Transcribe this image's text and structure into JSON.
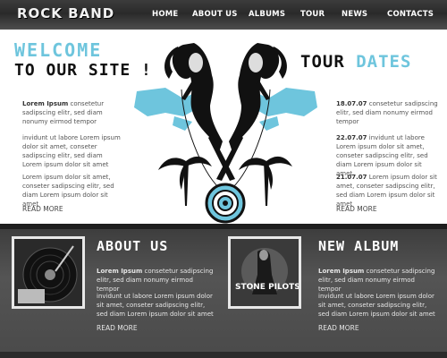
{
  "header": {
    "logo": "ROCK BAND",
    "nav": [
      "HOME",
      "ABOUT US",
      "ALBUMS",
      "TOUR",
      "NEWS",
      "CONTACTS"
    ]
  },
  "welcome": {
    "line1": "WELCOME",
    "line2": "TO OUR SITE !"
  },
  "intro": {
    "p1_bold": "Lorem Ipsum",
    "p1": " consetetur sadipscing elitr, sed diam nonumy eirmod tempor",
    "p2": "invidunt ut labore Lorem ipsum dolor sit amet, conseter sadipscing elitr, sed diam Lorem ipsum dolor sit amet",
    "p3": "Lorem ipsum dolor sit amet, conseter sadipscing elitr, sed diam Lorem ipsum dolor sit amet",
    "more": "READ MORE"
  },
  "tour": {
    "title_a": "TOUR",
    "title_b": "DATES",
    "items": [
      {
        "date": "18.07.07",
        "text": " consetetur sadipscing elitr, sed diam nonumy eirmod tempor"
      },
      {
        "date": "22.07.07",
        "text": " invidunt ut labore Lorem ipsum dolor sit amet, conseter sadipscing elitr, sed diam Lorem ipsum dolor sit amet"
      },
      {
        "date": "21.07.07",
        "text": " Lorem ipsum dolor sit amet, conseter sadipscing elitr, sed diam Lorem ipsum dolor sit amet"
      }
    ],
    "more": "READ MORE"
  },
  "about": {
    "title": "ABOUT US",
    "p1_bold": "Lorem Ipsum",
    "p1": " consetetur sadipscing elitr, sed diam nonumy eirmod tempor",
    "p2": "invidunt ut labore Lorem ipsum dolor sit amet, conseter sadipscing elitr, sed diam Lorem ipsum dolor sit amet",
    "more": "READ MORE"
  },
  "album": {
    "title": "NEW ALBUM",
    "cover_text": "STONE  PILOTS",
    "p1_bold": "Lorem Ipsum",
    "p1": " consetetur sadipscing elitr, sed diam nonumy eirmod tempor",
    "p2": "invidunt ut labore Lorem ipsum dolor sit amet, conseter sadipscing elitr, sed diam Lorem ipsum dolor sit amet",
    "more": "READ MORE"
  },
  "colors": {
    "accent": "#6ec5dd",
    "dark": "#2a2a2a"
  }
}
